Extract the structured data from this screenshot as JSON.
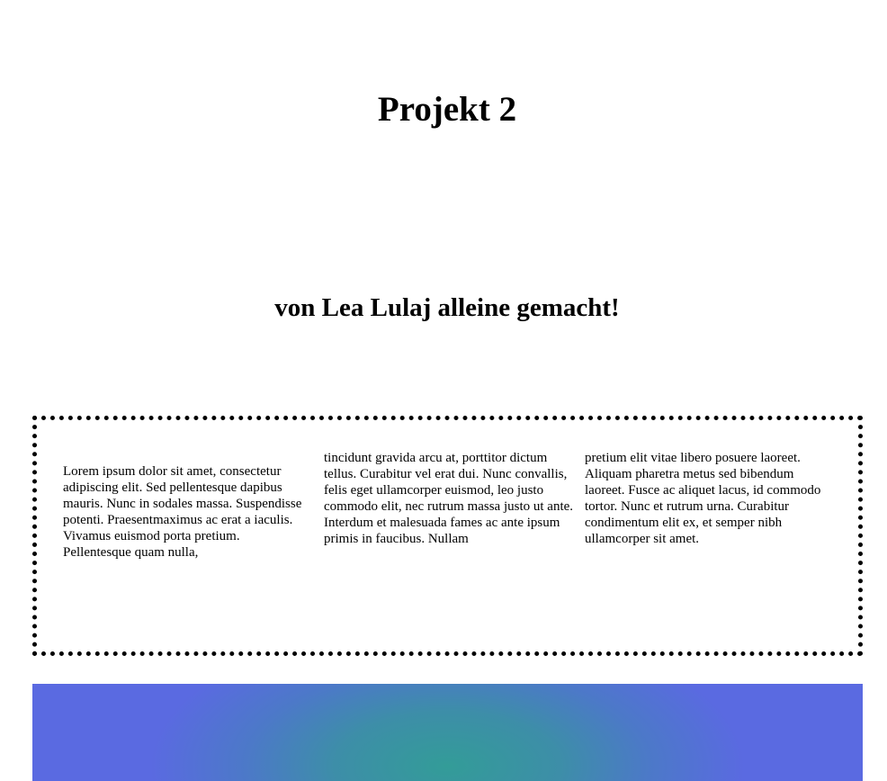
{
  "header": {
    "title": "Projekt 2",
    "subtitle": "von Lea Lulaj alleine gemacht!"
  },
  "text_box": {
    "columns": [
      "Lorem ipsum dolor sit amet, consectetur adipiscing elit. Sed pellentesque dapibus mauris. Nunc in sodales massa. Suspendisse potenti. Praesentmaximus ac erat a iaculis. Vivamus euismod porta pretium. Pellentesque quam nulla,",
      "tincidunt gravida arcu at, porttitor dictum tellus. Curabitur vel erat dui. Nunc convallis, felis eget ullamcorper euismod, leo justo commodo elit, nec rutrum massa justo ut ante. Interdum et malesuada fames ac ante ipsum primis in faucibus. Nullam",
      "pretium elit vitae libero posuere laoreet. Aliquam pharetra metus sed bibendum laoreet. Fusce ac aliquet lacus, id commodo tortor. Nunc et rutrum urna. Curabitur condimentum elit ex, et semper nibh ullamcorper sit amet."
    ],
    "border_style": "dotted"
  },
  "colors": {
    "background": "#ffffff",
    "text": "#000000",
    "gradient_center": "#339c98",
    "gradient_edge": "#5a6ae1"
  }
}
